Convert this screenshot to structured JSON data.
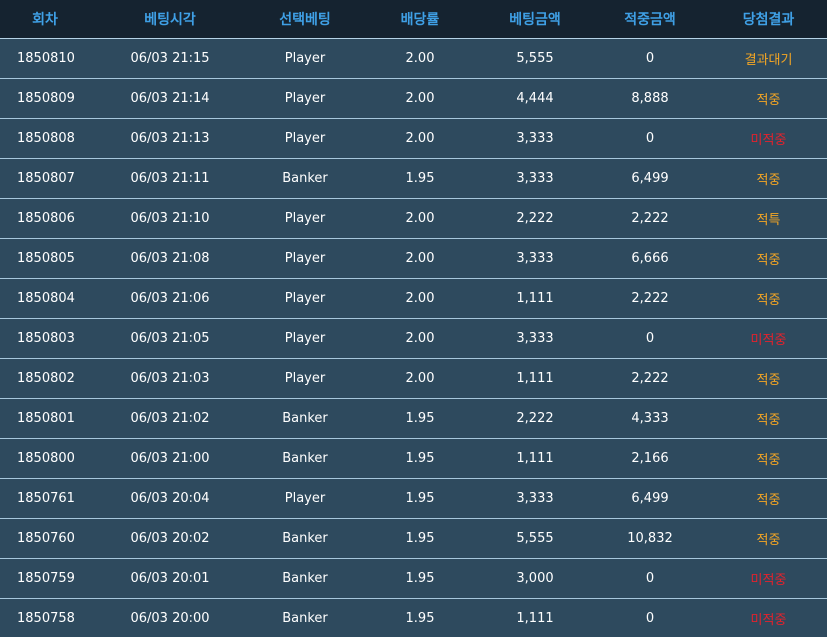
{
  "columns": [
    "회차",
    "베팅시각",
    "선택베팅",
    "배당률",
    "베팅금액",
    "적중금액",
    "당첨결과"
  ],
  "colors": {
    "header_bg": "#152330",
    "header_text": "#3fa0e6",
    "row_bg": "#2e4a5e",
    "row_border": "#a7c7dc",
    "result_orange": "#f5a623",
    "result_red": "#e5222c"
  },
  "rows": [
    {
      "round": "1850810",
      "time": "06/03 21:15",
      "pick": "Player",
      "odds": "2.00",
      "bet": "5,555",
      "win": "0",
      "result": "결과대기",
      "status": "pending"
    },
    {
      "round": "1850809",
      "time": "06/03 21:14",
      "pick": "Player",
      "odds": "2.00",
      "bet": "4,444",
      "win": "8,888",
      "result": "적중",
      "status": "hit"
    },
    {
      "round": "1850808",
      "time": "06/03 21:13",
      "pick": "Player",
      "odds": "2.00",
      "bet": "3,333",
      "win": "0",
      "result": "미적중",
      "status": "miss"
    },
    {
      "round": "1850807",
      "time": "06/03 21:11",
      "pick": "Banker",
      "odds": "1.95",
      "bet": "3,333",
      "win": "6,499",
      "result": "적중",
      "status": "hit"
    },
    {
      "round": "1850806",
      "time": "06/03 21:10",
      "pick": "Player",
      "odds": "2.00",
      "bet": "2,222",
      "win": "2,222",
      "result": "적특",
      "status": "tie"
    },
    {
      "round": "1850805",
      "time": "06/03 21:08",
      "pick": "Player",
      "odds": "2.00",
      "bet": "3,333",
      "win": "6,666",
      "result": "적중",
      "status": "hit"
    },
    {
      "round": "1850804",
      "time": "06/03 21:06",
      "pick": "Player",
      "odds": "2.00",
      "bet": "1,111",
      "win": "2,222",
      "result": "적중",
      "status": "hit"
    },
    {
      "round": "1850803",
      "time": "06/03 21:05",
      "pick": "Player",
      "odds": "2.00",
      "bet": "3,333",
      "win": "0",
      "result": "미적중",
      "status": "miss"
    },
    {
      "round": "1850802",
      "time": "06/03 21:03",
      "pick": "Player",
      "odds": "2.00",
      "bet": "1,111",
      "win": "2,222",
      "result": "적중",
      "status": "hit"
    },
    {
      "round": "1850801",
      "time": "06/03 21:02",
      "pick": "Banker",
      "odds": "1.95",
      "bet": "2,222",
      "win": "4,333",
      "result": "적중",
      "status": "hit"
    },
    {
      "round": "1850800",
      "time": "06/03 21:00",
      "pick": "Banker",
      "odds": "1.95",
      "bet": "1,111",
      "win": "2,166",
      "result": "적중",
      "status": "hit"
    },
    {
      "round": "1850761",
      "time": "06/03 20:04",
      "pick": "Player",
      "odds": "1.95",
      "bet": "3,333",
      "win": "6,499",
      "result": "적중",
      "status": "hit"
    },
    {
      "round": "1850760",
      "time": "06/03 20:02",
      "pick": "Banker",
      "odds": "1.95",
      "bet": "5,555",
      "win": "10,832",
      "result": "적중",
      "status": "hit"
    },
    {
      "round": "1850759",
      "time": "06/03 20:01",
      "pick": "Banker",
      "odds": "1.95",
      "bet": "3,000",
      "win": "0",
      "result": "미적중",
      "status": "miss"
    },
    {
      "round": "1850758",
      "time": "06/03 20:00",
      "pick": "Banker",
      "odds": "1.95",
      "bet": "1,111",
      "win": "0",
      "result": "미적중",
      "status": "miss"
    }
  ]
}
